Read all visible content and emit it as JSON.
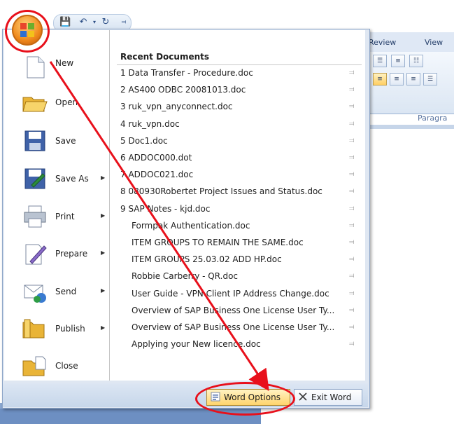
{
  "ribbon": {
    "tabs": [
      "Review",
      "View"
    ],
    "group_label": "Paragra"
  },
  "menu": {
    "left_items": [
      {
        "label": "New",
        "icon": "new-document-icon",
        "submenu": false
      },
      {
        "label": "Open",
        "icon": "open-folder-icon",
        "submenu": false
      },
      {
        "label": "Save",
        "icon": "save-icon",
        "submenu": false
      },
      {
        "label": "Save As",
        "icon": "save-as-icon",
        "submenu": true
      },
      {
        "label": "Print",
        "icon": "printer-icon",
        "submenu": true
      },
      {
        "label": "Prepare",
        "icon": "prepare-icon",
        "submenu": true
      },
      {
        "label": "Send",
        "icon": "send-icon",
        "submenu": true
      },
      {
        "label": "Publish",
        "icon": "publish-icon",
        "submenu": true
      },
      {
        "label": "Close",
        "icon": "close-folder-icon",
        "submenu": false
      }
    ],
    "recent_title": "Recent Documents",
    "recent_docs": [
      "1  Data Transfer - Procedure.doc",
      "2  AS400 ODBC 20081013.doc",
      "3  ruk_vpn_anyconnect.doc",
      "4  ruk_vpn.doc",
      "5  Doc1.doc",
      "6  ADDOC000.dot",
      "7  ADDOC021.doc",
      "8  080930Robertet Project Issues and Status.doc",
      "9  SAP Notes - kjd.doc",
      "Formpak Authentication.doc",
      "ITEM GROUPS TO REMAIN THE SAME.doc",
      "ITEM GROUPS 25.03.02 ADD HP.doc",
      "Robbie Carberry - QR.doc",
      "User Guide - VPN Client IP Address Change.doc",
      "Overview of SAP Business One License User Ty...",
      "Overview of SAP Business One License User Ty...",
      "Applying your New licence.doc"
    ],
    "word_options_label": "Word Options",
    "exit_word_label": "Exit Word"
  },
  "colors": {
    "highlight": "#e8101b",
    "menu_bg": "#dfe7f2",
    "options_button": "#ffd46c"
  }
}
